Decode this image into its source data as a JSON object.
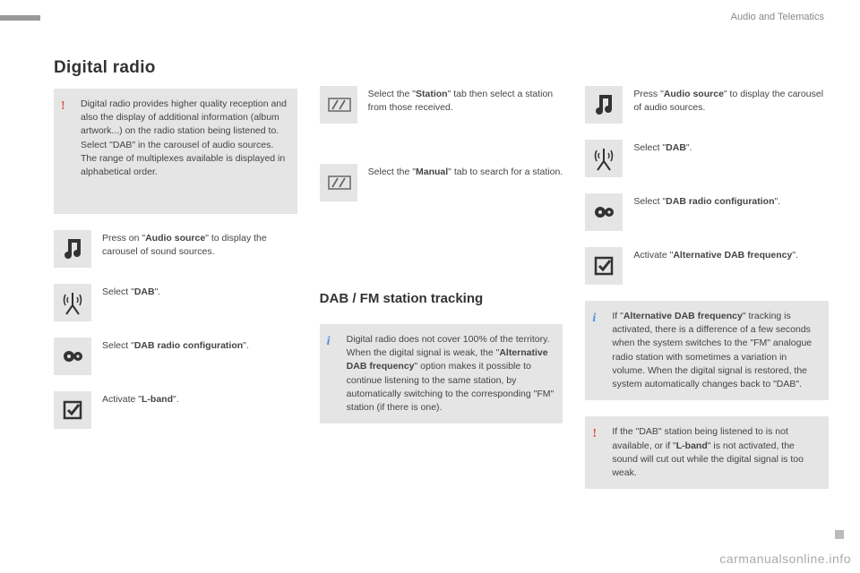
{
  "header": {
    "section": "Audio and Telematics"
  },
  "title": "Digital radio",
  "col1": {
    "intro": {
      "kind": "warn",
      "text": "Digital radio provides higher quality reception and also the display of additional information (album artwork...) on the radio station being listened to. Select \"DAB\" in the carousel of audio sources. The range of multiplexes available is displayed in alphabetical order."
    },
    "steps": [
      {
        "icon": "music-note-icon",
        "pre": "Press on \"",
        "bold": "Audio source",
        "post": "\" to display the carousel of sound sources."
      },
      {
        "icon": "antenna-icon",
        "pre": "Select \"",
        "bold": "DAB",
        "post": "\"."
      },
      {
        "icon": "gears-icon",
        "pre": "Select \"",
        "bold": "DAB radio configuration",
        "post": "\"."
      },
      {
        "icon": "checkbox-icon",
        "pre": "Activate \"",
        "bold": "L-band",
        "post": "\"."
      }
    ]
  },
  "col2": {
    "top_steps": [
      {
        "icon": "parallelogram-icon",
        "pre": "Select the \"",
        "bold": "Station",
        "post": "\" tab then select a station from those received."
      },
      {
        "icon": "parallelogram-icon",
        "pre": "Select the \"",
        "bold": "Manual",
        "post": "\" tab to search for a station."
      }
    ],
    "subheading": "DAB / FM station tracking",
    "info": {
      "kind": "info",
      "pre": "Digital radio does not cover 100% of the territory. When the digital signal is weak, the \"",
      "bold": "Alternative DAB frequency",
      "post": "\" option makes it possible to continue listening to the same station, by automatically switching to the corresponding \"FM\" station (if there is one)."
    }
  },
  "col3": {
    "steps": [
      {
        "icon": "music-note-icon",
        "pre": "Press \"",
        "bold": "Audio source",
        "post": "\" to display the carousel of audio sources."
      },
      {
        "icon": "antenna-icon",
        "pre": "Select \"",
        "bold": "DAB",
        "post": "\"."
      },
      {
        "icon": "gears-icon",
        "pre": "Select \"",
        "bold": "DAB radio configuration",
        "post": "\"."
      },
      {
        "icon": "checkbox-icon",
        "pre": "Activate \"",
        "bold": "Alternative DAB frequency",
        "post": "\"."
      }
    ],
    "info1": {
      "kind": "info",
      "pre": "If \"",
      "bold": "Alternative DAB frequency",
      "post": "\" tracking is activated, there is a difference of a few seconds when the system switches to the \"FM\" analogue radio station with sometimes a variation in volume. When the digital signal is restored, the system automatically changes back to \"DAB\"."
    },
    "info2": {
      "kind": "warn",
      "pre": "If the \"DAB\" station being listened to is not available, or if \"",
      "bold": "L-band",
      "post": "\" is not activated, the sound will cut out while the digital signal is too weak."
    }
  },
  "watermark": "carmanualsonline.info"
}
